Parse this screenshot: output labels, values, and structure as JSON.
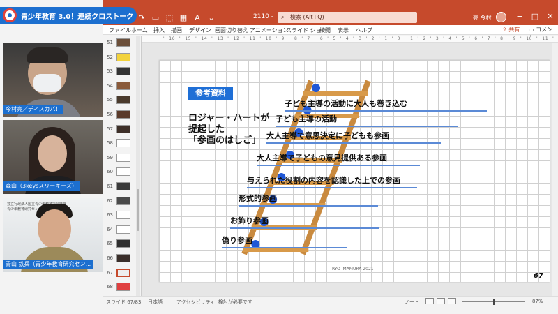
{
  "meeting": {
    "title": "青少年教育 3.0！連続クロストーク",
    "participants": [
      {
        "name": "今村亮／ディスカバ！"
      },
      {
        "name": "森山（3keysスリーキーズ）"
      },
      {
        "name": "青山 鉄兵（青少年教育研究セン..."
      }
    ],
    "poster_text": [
      "独立行政法人国立青少年教育振興機構",
      "青少年教育研究センター"
    ]
  },
  "ppt": {
    "titlebar": {
      "quick_access_icons": [
        "save-icon",
        "undo-icon",
        "redo-icon",
        "present-icon",
        "format-icon",
        "table-icon",
        "text-icon",
        "more-icon"
      ],
      "zoom": "2110 -",
      "search_placeholder": "検索 (Alt+Q)",
      "user_name": "亮 今村",
      "window_buttons": [
        "−",
        "□",
        "✕"
      ],
      "accent_color": "#c64a2c"
    },
    "menu": [
      "ファイル",
      "ホーム",
      "挿入",
      "描画",
      "デザイン",
      "画面切り替え",
      "アニメーション",
      "スライド ショー",
      "校閲",
      "表示",
      "ヘルプ"
    ],
    "share_label": "共有",
    "comment_label": "コメント",
    "ruler_text": "' 16 ' 15 ' 14 ' 13 ' 12 ' 11 ' 10 ' 9 ' 8 ' 7 ' 6 ' 5 ' 4 ' 3 ' 2 ' 1 ' 0 ' 1 ' 2 ' 3 ' 4 ' 5 ' 6 ' 7 ' 8 ' 9 ' 10 ' 11 ' 12 ' 13 ' 14 ' 15 ' 16 '",
    "thumbnails": [
      {
        "num": "51",
        "color": "#6b4f3a"
      },
      {
        "num": "52",
        "color": "#f2d23c"
      },
      {
        "num": "53",
        "color": "#333333"
      },
      {
        "num": "54",
        "color": "#8a5a3a"
      },
      {
        "num": "55",
        "color": "#4a3a2c"
      },
      {
        "num": "56",
        "color": "#5a3a2a"
      },
      {
        "num": "57",
        "color": "#3d2f28"
      },
      {
        "num": "58",
        "color": "#ffffff"
      },
      {
        "num": "59",
        "color": "#ffffff"
      },
      {
        "num": "60",
        "color": "#ffffff"
      },
      {
        "num": "61",
        "color": "#3a3a3a"
      },
      {
        "num": "62",
        "color": "#4a4a4a"
      },
      {
        "num": "63",
        "color": "#ffffff"
      },
      {
        "num": "64",
        "color": "#ffffff"
      },
      {
        "num": "65",
        "color": "#2f2f2f"
      },
      {
        "num": "66",
        "color": "#3a2e2a"
      },
      {
        "num": "67",
        "color": "#eeeeee",
        "selected": true
      },
      {
        "num": "68",
        "color": "#e04040"
      }
    ],
    "slide": {
      "ref_label": "参考資料",
      "intro_lines": [
        "ロジャー・ハートが",
        "提起した",
        "「参画のはしご」"
      ],
      "rungs": [
        "子ども主導の活動に大人も巻き込む",
        "子ども主導の活動",
        "大人主導で意思決定に子どもも参画",
        "大人主導で子どもの意見提供ある参画",
        "与えられた役割の内容を認識した上での参画",
        "形式的参画",
        "お飾り参画",
        "偽り参画"
      ],
      "credit": "RYO IMAMURA 2021",
      "slide_number": "67"
    },
    "status": {
      "slide": "スライド 67/83",
      "language": "日本語",
      "accessibility": "アクセシビリティ: 検討が必要です",
      "notes": "ノート",
      "zoom": "87%"
    }
  }
}
